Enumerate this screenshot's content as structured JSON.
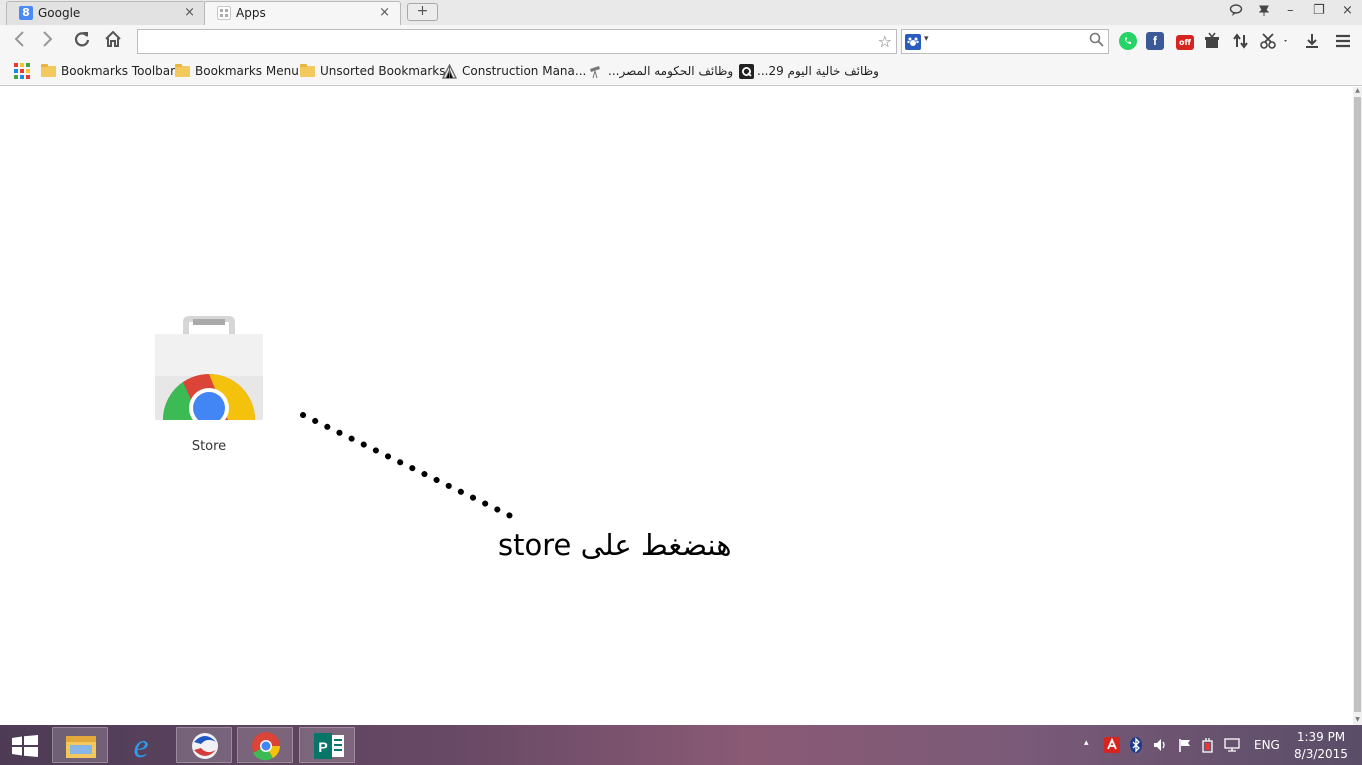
{
  "tabs": [
    {
      "title": "Google",
      "favicon": "google-g-icon",
      "close": "×"
    },
    {
      "title": "Apps",
      "favicon": "apps-grid-icon",
      "close": "×"
    }
  ],
  "new_tab": "+",
  "window_controls": {
    "feedback": "⌕",
    "pin": "✦",
    "minimize": "–",
    "restore": "❐",
    "close": "×"
  },
  "nav": {
    "back": "‹",
    "forward": "›",
    "reload": "↻",
    "home": "⌂"
  },
  "omnibox": {
    "value": "",
    "placeholder": ""
  },
  "search": {
    "value": "",
    "dropdown": "▾"
  },
  "bookmarks": [
    {
      "label": "Bookmarks Toolbar",
      "icon": "folder-icon"
    },
    {
      "label": "Bookmarks Menu",
      "icon": "folder-icon"
    },
    {
      "label": "Unsorted Bookmarks",
      "icon": "folder-icon"
    },
    {
      "label": "Construction Mana...",
      "icon": "construction-icon"
    },
    {
      "label": "وظائف الحكومه المصر...",
      "icon": "telescope-icon"
    },
    {
      "label": "وظائف خالية اليوم 29...",
      "icon": "q-logo-icon"
    }
  ],
  "apps": [
    {
      "label": "Store",
      "icon": "chrome-web-store-icon"
    }
  ],
  "annotation": "هنضغط على store",
  "taskbar": {
    "language": "ENG",
    "time": "1:39 PM",
    "date": "8/3/2015",
    "tray_expand": "▴"
  },
  "colors": {
    "tabstrip": "#e9e9e9",
    "toolbar": "#f6f6f6",
    "whatsapp": "#25d366",
    "facebook": "#3b5998",
    "offer": "#d8241f",
    "store_red": "#db4437",
    "store_yellow": "#f4c20d",
    "store_green": "#3cba54",
    "store_blue": "#4285f4"
  }
}
